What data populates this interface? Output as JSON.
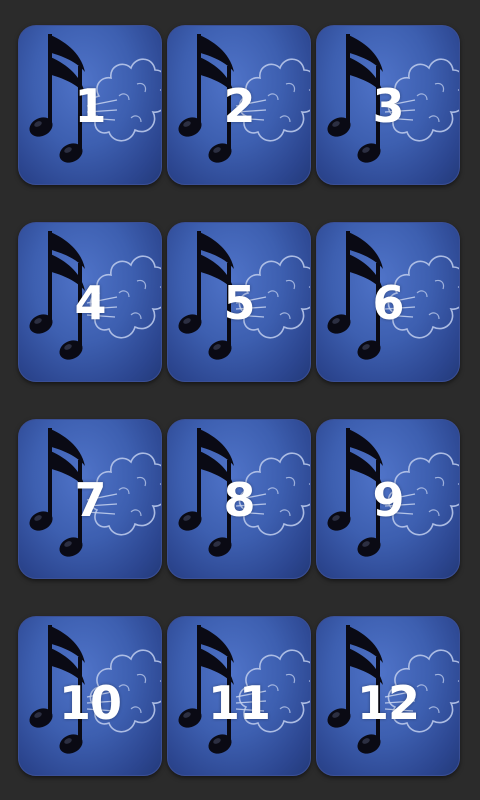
{
  "colors": {
    "background": "#2b2b2b",
    "tile": "#3d5fb0",
    "tile_border": "#3a4f96",
    "text": "#ffffff"
  },
  "tile_icon": "music-note-cloud-icon",
  "buttons": [
    {
      "label": "1"
    },
    {
      "label": "2"
    },
    {
      "label": "3"
    },
    {
      "label": "4"
    },
    {
      "label": "5"
    },
    {
      "label": "6"
    },
    {
      "label": "7"
    },
    {
      "label": "8"
    },
    {
      "label": "9"
    },
    {
      "label": "10"
    },
    {
      "label": "11"
    },
    {
      "label": "12"
    }
  ]
}
